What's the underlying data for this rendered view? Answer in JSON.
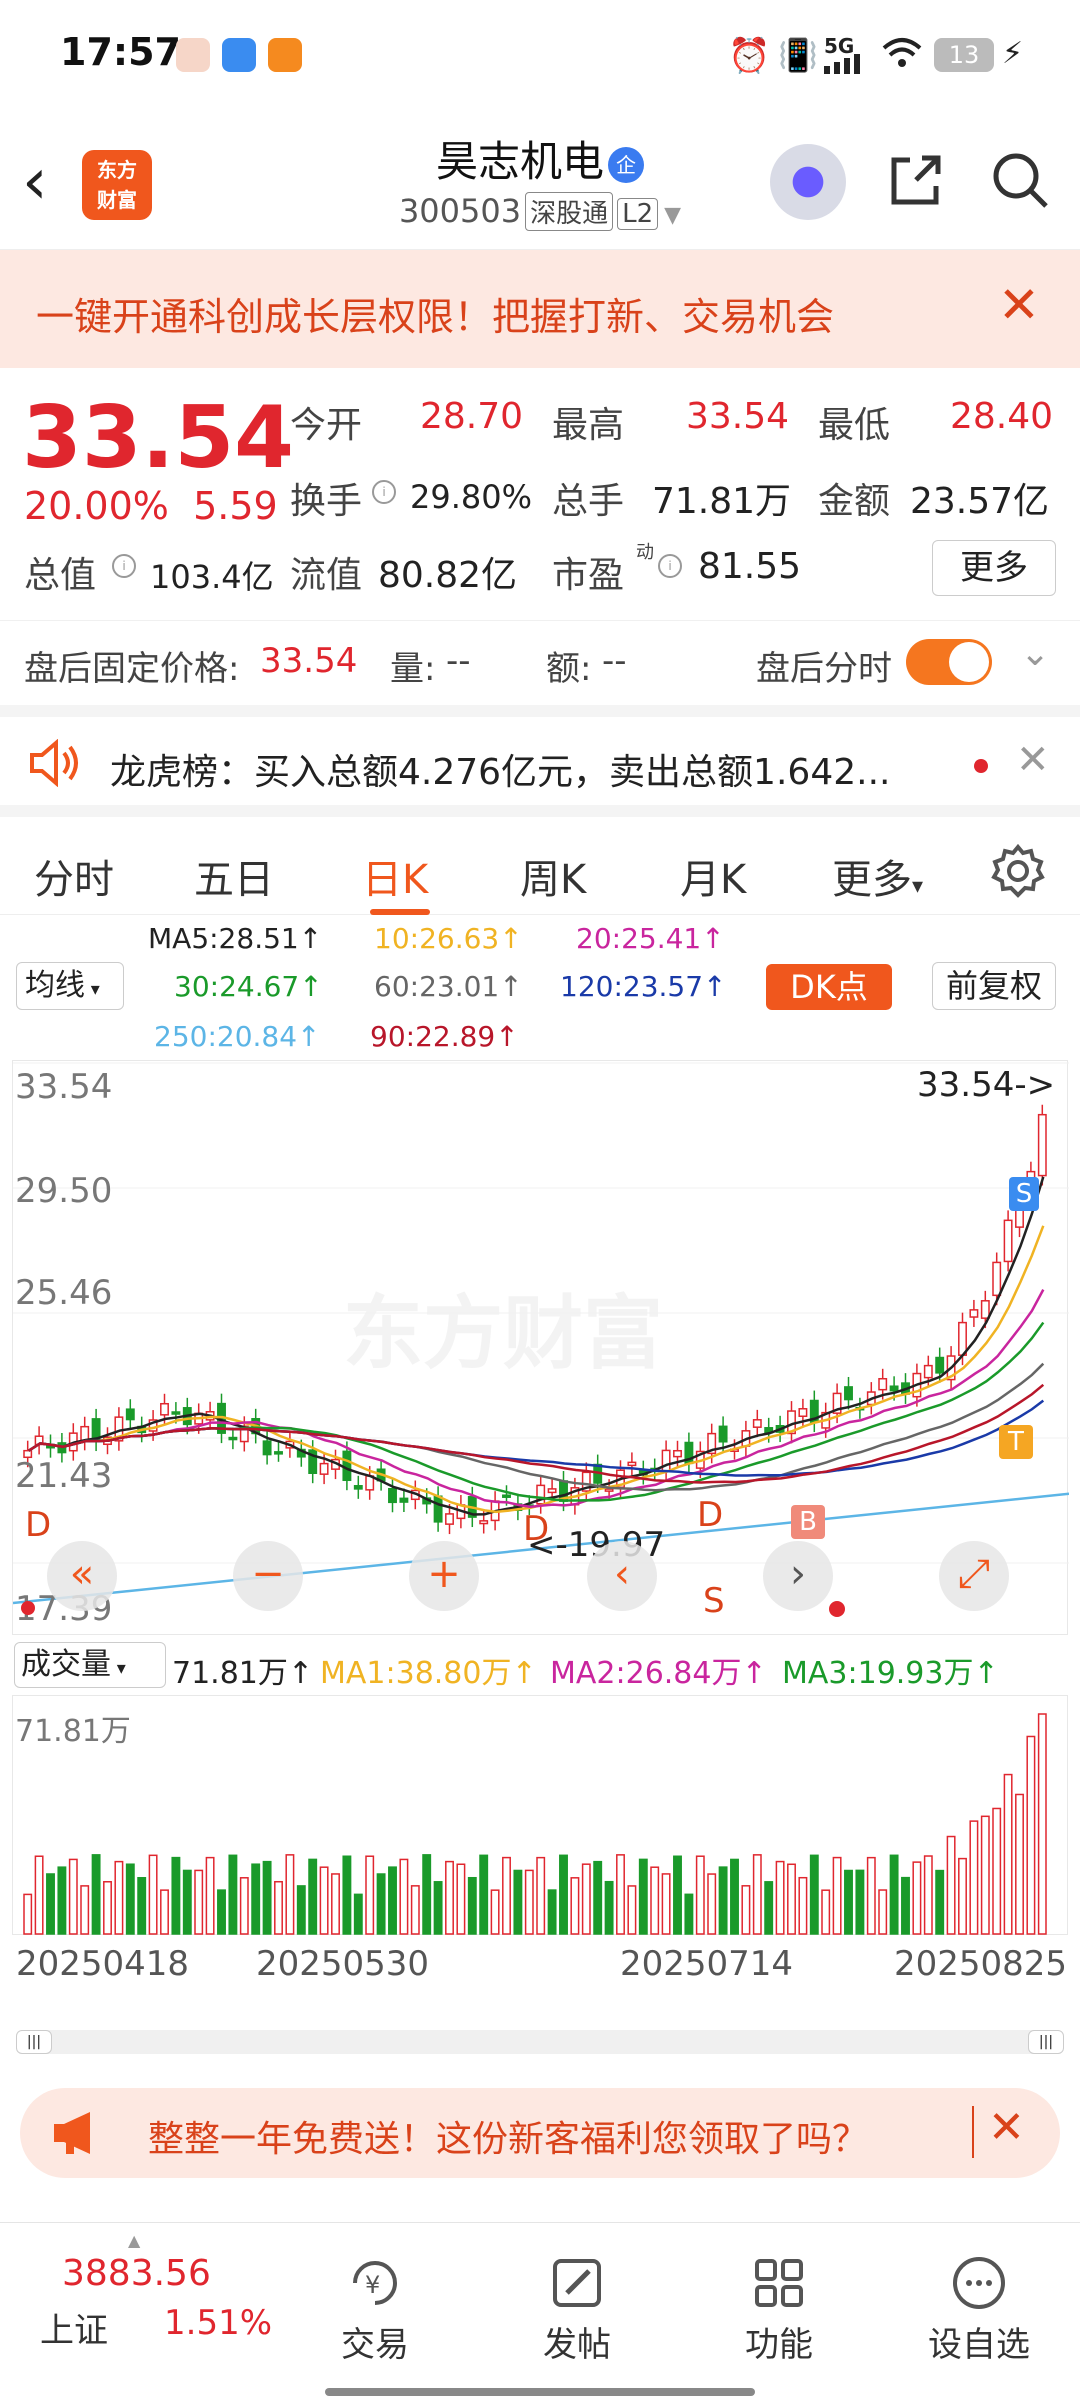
{
  "status": {
    "time": "17:57",
    "signal": "5G",
    "battery": "13"
  },
  "header": {
    "logo": "东方财富",
    "name": "昊志机电",
    "name_badge": "企",
    "code": "300503",
    "exchange_tag": "深股通",
    "level_tag": "L2"
  },
  "banner": {
    "text": "一键开通科创成长层权限！把握打新、交易机会",
    "close": "✕"
  },
  "quote": {
    "price": "33.54",
    "change_pct": "20.00%",
    "change_amt": "5.59",
    "open_label": "今开",
    "open": "28.70",
    "high_label": "最高",
    "high": "33.54",
    "low_label": "最低",
    "low": "28.40",
    "turnover_label": "换手",
    "turnover": "29.80%",
    "volume_label": "总手",
    "volume": "71.81万",
    "amount_label": "金额",
    "amount": "23.57亿",
    "mktcap_label": "总值",
    "mktcap": "103.4亿",
    "float_label": "流值",
    "float": "80.82亿",
    "pe_label": "市盈",
    "pe_sup": "动",
    "pe": "81.55",
    "more": "更多"
  },
  "after_hours": {
    "price_label": "盘后固定价格:",
    "price": "33.54",
    "vol_label": "量:",
    "vol": "--",
    "amt_label": "额:",
    "amt": "--",
    "toggle_label": "盘后分时"
  },
  "dragon_tiger": {
    "text": "龙虎榜：买入总额4.276亿元，卖出总额1.642..."
  },
  "tabs": [
    "分时",
    "五日",
    "日K",
    "周K",
    "月K",
    "更多"
  ],
  "active_tab": "日K",
  "ma_legend": {
    "ma5": "MA5:28.51↑",
    "ma10": "10:26.63↑",
    "ma20": "20:25.41↑",
    "ma30": "30:24.67↑",
    "ma60": "60:23.01↑",
    "ma120": "120:23.57↑",
    "ma250": "250:20.84↑",
    "ma90": "90:22.89↑",
    "ma_select": "均线",
    "dk_button": "DK点",
    "adjust_button": "前复权",
    "colors": {
      "ma5": "#222222",
      "ma10": "#f0b323",
      "ma20": "#c9259e",
      "ma30": "#1a9a2a",
      "ma60": "#666666",
      "ma120": "#1a3aa8",
      "ma250": "#5cb5e6",
      "ma90": "#b8162a"
    }
  },
  "kline": {
    "y_labels": [
      "33.54",
      "29.50",
      "25.46",
      "21.43",
      "17.39"
    ],
    "last_price_tag": "33.54->",
    "min_tag": "<-19.97",
    "markers": {
      "s_top": "S",
      "t": "T",
      "b": "B",
      "d": "D",
      "s_bottom": "S"
    },
    "watermark": "东方财富"
  },
  "volume": {
    "select": "成交量",
    "vol": "71.81万↑",
    "ma1": "MA1:38.80万↑",
    "ma2": "MA2:26.84万↑",
    "ma3": "MA3:19.93万↑",
    "max_label": "71.81万",
    "dates": [
      "20250418",
      "20250530",
      "20250714",
      "20250825"
    ]
  },
  "promo": {
    "text": "整整一年免费送！这份新客福利您领取了吗？"
  },
  "bottom_nav": {
    "index_value": "3883.56",
    "index_name": "上证",
    "index_change": "1.51%",
    "items": [
      "交易",
      "发帖",
      "功能",
      "设自选"
    ]
  }
}
